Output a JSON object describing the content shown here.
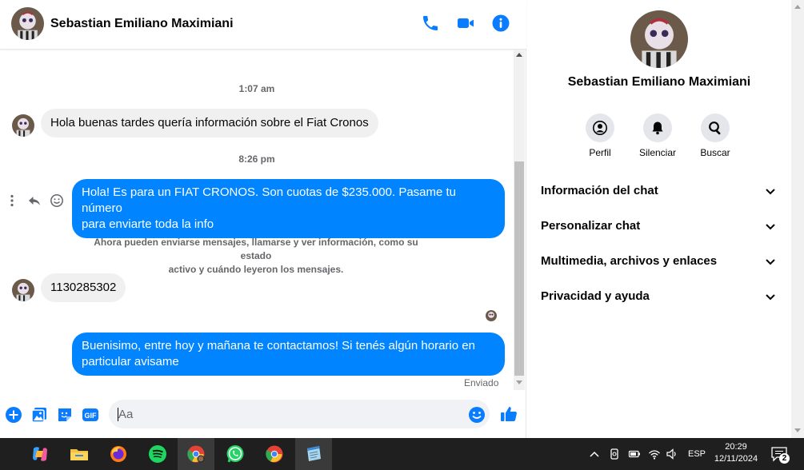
{
  "header": {
    "contact_name": "Sebastian Emiliano Maximiani"
  },
  "messages": {
    "timestamps": [
      "1:07 am",
      "8:26 pm"
    ],
    "incoming_1": "Hola buenas tardes quería información sobre el Fiat Cronos",
    "outgoing_1_line1": "Hola! Es para un FIAT CRONOS. Son cuotas de $235.000. Pasame tu número",
    "outgoing_1_line2": "para enviarte toda la info",
    "system_line1": "Ahora pueden enviarse mensajes, llamarse y ver información, como su estado",
    "system_line2": "activo y cuándo leyeron los mensajes.",
    "incoming_2": "1130285302",
    "outgoing_2_line1": "Buenisimo, entre hoy y mañana te contactamos! Si tenés algún horario en",
    "outgoing_2_line2": "particular avisame",
    "status": "Enviado"
  },
  "composer": {
    "placeholder": "Aa",
    "gif_label": "GIF"
  },
  "info": {
    "name": "Sebastian Emiliano Maximiani",
    "actions": [
      "Perfil",
      "Silenciar",
      "Buscar"
    ],
    "sections": [
      "Información del chat",
      "Personalizar chat",
      "Multimedia, archivos y enlaces",
      "Privacidad y ayuda"
    ]
  },
  "taskbar": {
    "language": "ESP",
    "time": "20:29",
    "date": "12/11/2024",
    "notification_count": "2"
  },
  "colors": {
    "accent": "#0084ff",
    "incoming_bubble": "#f0f0f0"
  }
}
